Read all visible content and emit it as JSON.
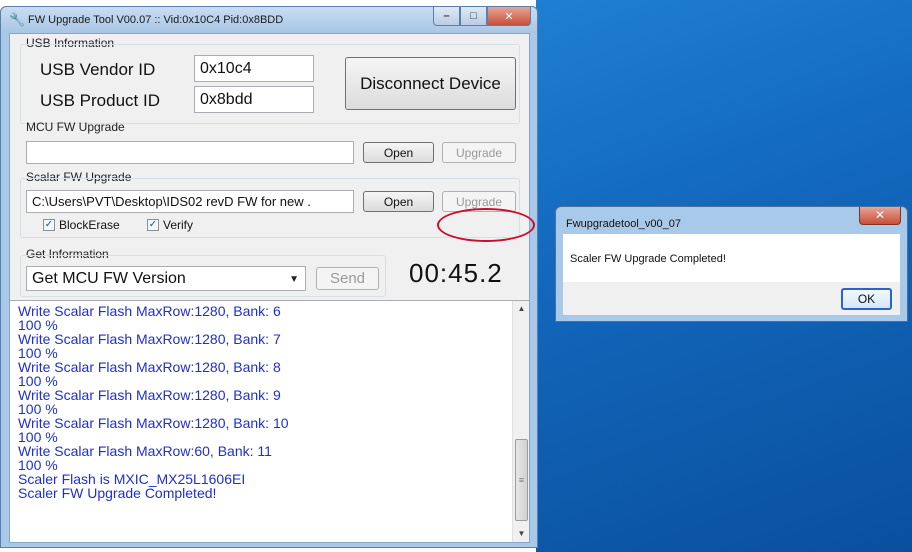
{
  "main_window": {
    "title": "FW Upgrade Tool V00.07 :: Vid:0x10C4 Pid:0x8BDD",
    "controls": {
      "minimize": "–",
      "maximize": "□",
      "close": "✕"
    }
  },
  "usb": {
    "group_label": "USB Information",
    "vendor_label": "USB Vendor ID",
    "vendor_value": "0x10c4",
    "product_label": "USB Product ID",
    "product_value": "0x8bdd",
    "disconnect_label": "Disconnect Device"
  },
  "mcu": {
    "group_label": "MCU FW Upgrade",
    "path_value": "",
    "open_label": "Open",
    "upgrade_label": "Upgrade"
  },
  "scalar": {
    "group_label": "Scalar FW Upgrade",
    "path_value": "C:\\Users\\PVT\\Desktop\\IDS02 revD FW for new .",
    "open_label": "Open",
    "upgrade_label": "Upgrade",
    "block_erase_label": "BlockErase",
    "block_erase_checked": true,
    "verify_label": "Verify",
    "verify_checked": true
  },
  "info": {
    "group_label": "Get Information",
    "selected": "Get MCU FW Version",
    "send_label": "Send",
    "timer": "00:45.2"
  },
  "log": {
    "lines": [
      "Write Scalar Flash MaxRow:1280, Bank: 6",
      "100 %",
      "Write Scalar Flash MaxRow:1280, Bank: 7",
      "100 %",
      "Write Scalar Flash MaxRow:1280, Bank: 8",
      "100 %",
      "Write Scalar Flash MaxRow:1280, Bank: 9",
      "100 %",
      "Write Scalar Flash MaxRow:1280, Bank: 10",
      "100 %",
      "Write Scalar Flash MaxRow:60, Bank: 11",
      "100 %",
      "Scaler Flash is MXIC_MX25L1606EI",
      "Scaler FW Upgrade Completed!"
    ],
    "color": "#1f2fd0"
  },
  "dialog": {
    "title": "Fwupgradetool_v00_07",
    "message": "Scaler FW Upgrade Completed!",
    "ok_label": "OK",
    "close_label": "✕"
  },
  "colors": {
    "desktop": "#1268bd",
    "window_frame": "#a9c9ea",
    "highlight": "#c8102e"
  }
}
